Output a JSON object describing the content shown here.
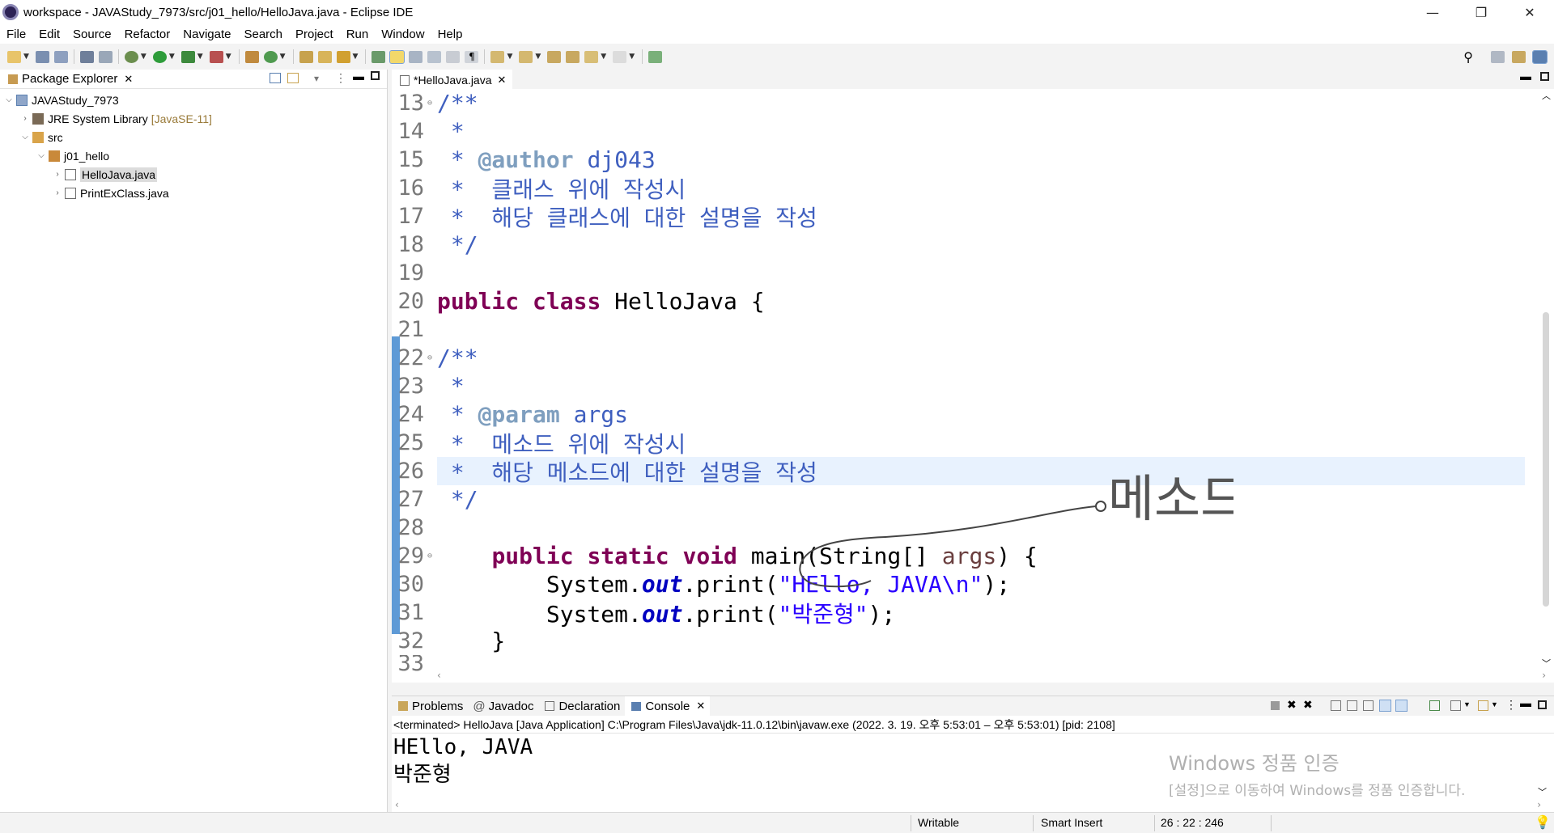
{
  "window": {
    "title": "workspace - JAVAStudy_7973/src/j01_hello/HelloJava.java - Eclipse IDE",
    "minimize": "—",
    "restore": "❐",
    "close": "✕"
  },
  "menu": [
    "File",
    "Edit",
    "Source",
    "Refactor",
    "Navigate",
    "Search",
    "Project",
    "Run",
    "Window",
    "Help"
  ],
  "package_explorer": {
    "tab_label": "Package Explorer",
    "project": "JAVAStudy_7973",
    "jre": "JRE System Library",
    "jre_decoration": "[JavaSE-11]",
    "src": "src",
    "package": "j01_hello",
    "files": [
      "HelloJava.java",
      "PrintExClass.java"
    ]
  },
  "editor": {
    "tab_label": "*HelloJava.java",
    "line_numbers": [
      "13",
      "14",
      "15",
      "16",
      "17",
      "18",
      "19",
      "20",
      "21",
      "22",
      "23",
      "24",
      "25",
      "26",
      "27",
      "28",
      "29",
      "30",
      "31",
      "32",
      "33"
    ],
    "annotation_text": "메소드"
  },
  "console": {
    "tabs": [
      "Problems",
      "Javadoc",
      "Declaration",
      "Console"
    ],
    "info": "<terminated> HelloJava [Java Application] C:\\Program Files\\Java\\jdk-11.0.12\\bin\\javaw.exe  (2022. 3. 19. 오후 5:53:01 – 오후 5:53:01) [pid: 2108]",
    "output": [
      "HEllo, JAVA",
      "박준형"
    ]
  },
  "watermark": {
    "line1": "Windows 정품 인증",
    "line2": "[설정]으로 이동하여 Windows를 정품 인증합니다."
  },
  "status": {
    "writable": "Writable",
    "insert_mode": "Smart Insert",
    "position": "26 : 22 : 246"
  },
  "colors": {
    "keyword": "#7f0055",
    "javadoc": "#3f5fbf",
    "string": "#2a00ff",
    "static_field": "#0000c0",
    "current_line": "#e8f2fe",
    "change_bar": "#5e9ad6"
  }
}
